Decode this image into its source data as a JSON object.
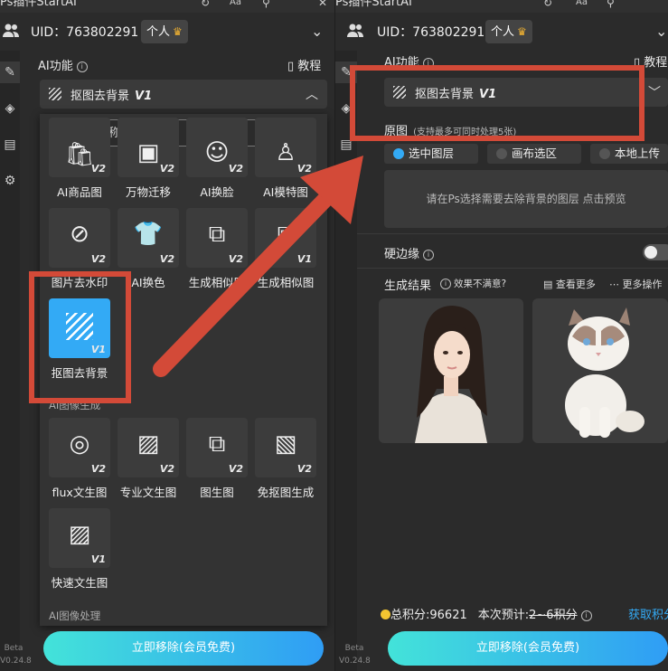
{
  "app": {
    "title": "Ps插件StartAI",
    "window_icons": [
      "refresh-icon",
      "font-size-icon",
      "pin-icon",
      "close-icon"
    ]
  },
  "user": {
    "uid_label": "UID：763802291",
    "plan_label": "个人"
  },
  "nav": {
    "beta": "Beta",
    "version": "V0.24.8",
    "icons": [
      "brush-icon",
      "layers-icon",
      "document-icon",
      "settings-icon"
    ]
  },
  "section": {
    "ai_functions": "AI功能",
    "tutorial": "教程"
  },
  "selected_function": {
    "label": "抠图去背景",
    "version": "V1"
  },
  "dropdown": {
    "search_placeholder": "输入名称搜索",
    "row1": [
      {
        "label": "AI商品图",
        "version": "V2",
        "icon": "product-image-icon"
      },
      {
        "label": "万物迁移",
        "version": "V2",
        "icon": "migrate-icon"
      },
      {
        "label": "AI换脸",
        "version": "V2",
        "icon": "face-swap-icon"
      },
      {
        "label": "AI模特图",
        "version": "V2",
        "icon": "model-icon"
      }
    ],
    "row2": [
      {
        "label": "图片去水印",
        "version": "V2",
        "icon": "watermark-remove-icon"
      },
      {
        "label": "AI换色",
        "version": "V2",
        "icon": "recolor-icon"
      },
      {
        "label": "生成相似图",
        "version": "V2",
        "icon": "similar-image-icon"
      },
      {
        "label": "生成相似图",
        "version": "V1",
        "icon": "similar-image-icon"
      }
    ],
    "highlighted": {
      "label": "抠图去背景",
      "version": "V1"
    },
    "group_generation": "AI图像生成",
    "row3": [
      {
        "label": "flux文生图",
        "version": "V2",
        "icon": "flux-icon"
      },
      {
        "label": "专业文生图",
        "version": "V2",
        "icon": "text-to-image-icon"
      },
      {
        "label": "图生图",
        "version": "V2",
        "icon": "image-to-image-icon"
      },
      {
        "label": "免抠图生成",
        "version": "V2",
        "icon": "cutout-free-icon"
      }
    ],
    "row4": [
      {
        "label": "快速文生图",
        "version": "V1",
        "icon": "text-to-image-icon"
      }
    ],
    "group_processing": "AI图像处理"
  },
  "source": {
    "title": "原图",
    "hint": "(支持最多可同时处理5张)",
    "options": [
      "选中图层",
      "画布选区",
      "本地上传"
    ],
    "selected_option": "选中图层",
    "empty_text": "请在Ps选择需要去除背景的图层 点击预览"
  },
  "hard_edge": {
    "label": "硬边缘",
    "enabled": false
  },
  "results": {
    "title": "生成结果",
    "unsatisfied": "效果不满意?",
    "view_more": "查看更多",
    "more_actions": "更多操作"
  },
  "points": {
    "total": "总积分:96621",
    "estimate_prefix": "本次预计:",
    "estimate_value": "2~6积分",
    "get_points": "获取积分"
  },
  "cta": {
    "label": "立即移除(会员免费)"
  },
  "colors": {
    "accent": "#33aaf5",
    "annotation": "#d34a38",
    "cta_start": "#43e3d9",
    "cta_end": "#2f9df5"
  }
}
